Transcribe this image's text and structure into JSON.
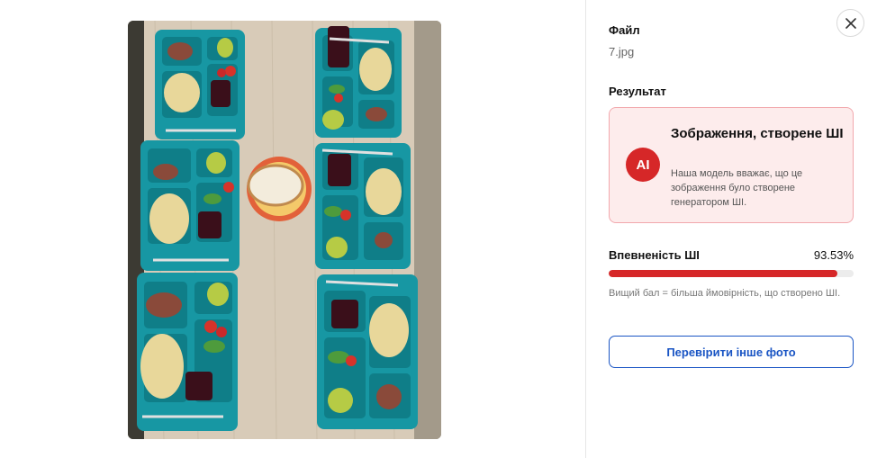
{
  "panel": {
    "file_label": "Файл",
    "file_name": "7.jpg",
    "result_label": "Результат",
    "result": {
      "badge": "AI",
      "title": "Зображення, створене ШІ",
      "description": "Наша модель вважає, що це зображення було створене генератором ШІ."
    },
    "confidence": {
      "label": "Впевненість ШІ",
      "value_text": "93.53%",
      "value": 93.53,
      "hint": "Вищий бал = більша ймовірність, що створено ШІ."
    },
    "check_another_label": "Перевірити інше фото",
    "close_icon": "close-icon"
  },
  "colors": {
    "accent_red": "#d62728",
    "result_bg": "#fdecec",
    "result_border": "#f2a8ad",
    "button_blue": "#1a55c4",
    "tray_teal": "#1a9aa6"
  }
}
